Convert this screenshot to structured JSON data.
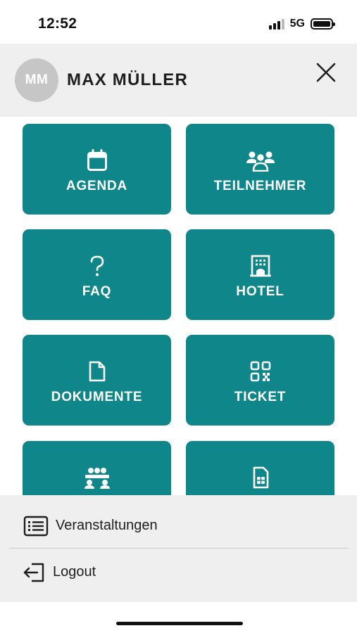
{
  "status_bar": {
    "time": "12:52",
    "network": "5G"
  },
  "header": {
    "avatar_initials": "MM",
    "user_name": "MAX MÜLLER"
  },
  "tiles": [
    {
      "label": "AGENDA",
      "icon": "calendar-icon"
    },
    {
      "label": "TEILNEHMER",
      "icon": "participants-icon"
    },
    {
      "label": "FAQ",
      "icon": "question-icon"
    },
    {
      "label": "HOTEL",
      "icon": "hotel-icon"
    },
    {
      "label": "DOKUMENTE",
      "icon": "document-icon"
    },
    {
      "label": "TICKET",
      "icon": "qr-code-icon"
    },
    {
      "label": "",
      "icon": "meeting-table-icon"
    },
    {
      "label": "",
      "icon": "sim-card-icon"
    }
  ],
  "menu": {
    "events_label": "Veranstaltungen",
    "logout_label": "Logout"
  },
  "colors": {
    "tile_background": "#0f878a",
    "header_background": "#efefef",
    "avatar_background": "#c6c6c6"
  }
}
